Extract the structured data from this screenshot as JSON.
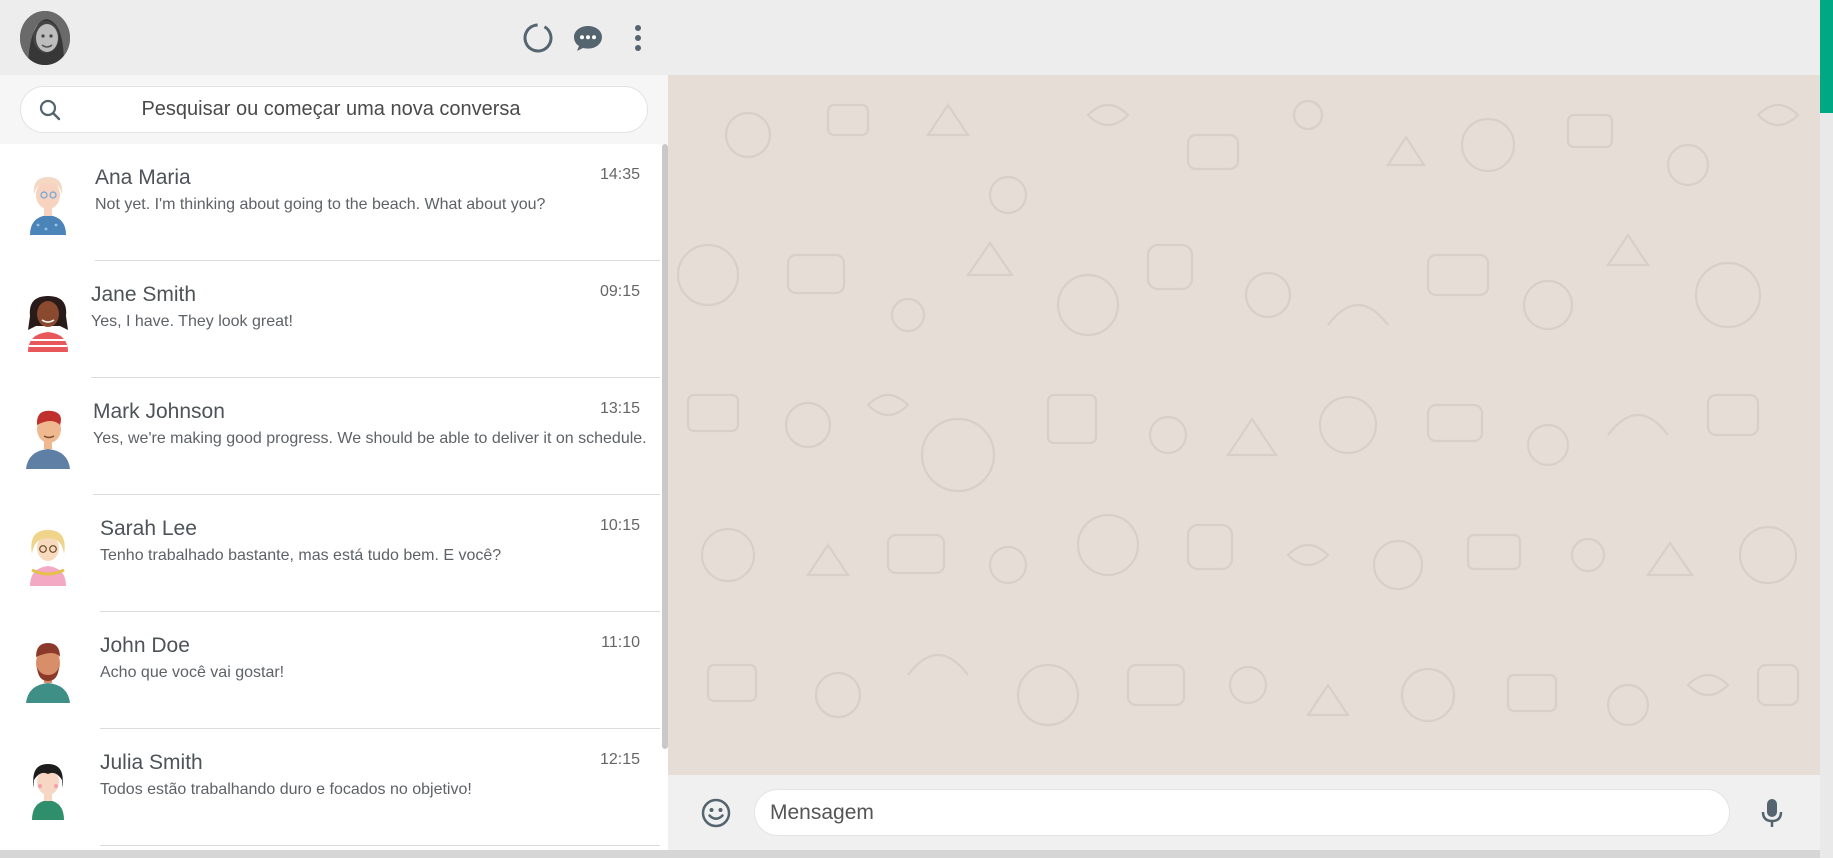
{
  "header": {
    "avatar_icon": "user-avatar",
    "status_icon": "status-ring-icon",
    "new_chat_icon": "chat-bubble-icon",
    "menu_icon": "more-vertical-icon"
  },
  "search": {
    "placeholder": "Pesquisar ou começar uma nova conversa",
    "icon": "search-icon"
  },
  "chats": [
    {
      "name": "Ana Maria",
      "message": "Not yet. I'm thinking about going to the beach. What about you?",
      "time": "14:35"
    },
    {
      "name": "Jane Smith",
      "message": "Yes, I have. They look great!",
      "time": "09:15"
    },
    {
      "name": "Mark Johnson",
      "message": "Yes, we're making good progress. We should be able to deliver it on schedule.",
      "time": "13:15"
    },
    {
      "name": "Sarah Lee",
      "message": "Tenho trabalhado bastante, mas está tudo bem. E você?",
      "time": "10:15"
    },
    {
      "name": "John Doe",
      "message": "Acho que você vai gostar!",
      "time": "11:10"
    },
    {
      "name": "Julia Smith",
      "message": "Todos estão trabalhando duro e focados no objetivo!",
      "time": "12:15"
    }
  ],
  "composer": {
    "placeholder": "Mensagem",
    "emoji_icon": "emoji-icon",
    "mic_icon": "microphone-icon"
  },
  "colors": {
    "accent": "#00a884",
    "header_bg": "#ededed",
    "wallpaper": "#e5ddd6"
  }
}
